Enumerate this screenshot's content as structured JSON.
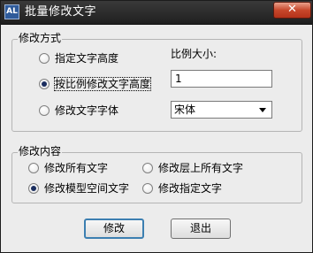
{
  "window": {
    "title": "批量修改文字",
    "app_icon_glyph": "AL",
    "close_glyph": "✕"
  },
  "method_group": {
    "legend": "修改方式",
    "options": [
      {
        "label": "指定文字高度",
        "checked": false
      },
      {
        "label": "按比例修改文字高度",
        "checked": true
      },
      {
        "label": "修改文字字体",
        "checked": false
      }
    ],
    "scale_label": "比例大小:",
    "scale_value": "1",
    "font_value": "宋体"
  },
  "content_group": {
    "legend": "修改内容",
    "options": [
      {
        "label": "修改所有文字",
        "checked": false
      },
      {
        "label": "修改层上所有文字",
        "checked": false
      },
      {
        "label": "修改模型空间文字",
        "checked": true
      },
      {
        "label": "修改指定文字",
        "checked": false
      }
    ]
  },
  "buttons": {
    "modify": "修改",
    "exit": "退出"
  },
  "colors": {
    "titlebar": "#2a2a2a",
    "dialog_bg": "#ececec",
    "close_button": "#c7472b",
    "default_button_border": "#3c7fb1"
  }
}
